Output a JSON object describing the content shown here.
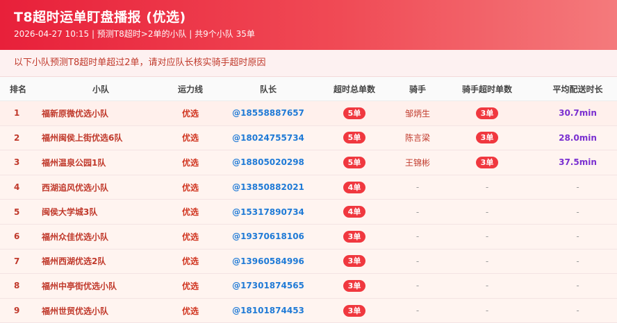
{
  "header": {
    "title": "T8超时运单盯盘播报 (优选)",
    "subtitle": "2026-04-27 10:15 | 预测T8超时>2单的小队 | 共9个小队 35单"
  },
  "notice": "以下小队预测T8超时单超过2单，请对应队长核实骑手超时原因",
  "colors": {
    "header_gradient_start": "#e8203a",
    "header_gradient_end": "#f47a7c",
    "pill": "#f0383f",
    "leader_link": "#1f7ad6",
    "avg_time": "#7a2fd0",
    "team_text": "#c0392b"
  },
  "table": {
    "columns": [
      "排名",
      "小队",
      "运力线",
      "队长",
      "超时总单数",
      "骑手",
      "骑手超时单数",
      "平均配送时长"
    ],
    "rows": [
      {
        "rank": "1",
        "team": "福新原微优选小队",
        "line": "优选",
        "leader": "@18558887657",
        "total": "5单",
        "rider": "邹炳生",
        "rider_ot": "3单",
        "avg": "30.7min"
      },
      {
        "rank": "2",
        "team": "福州闽侯上街优选6队",
        "line": "优选",
        "leader": "@18024755734",
        "total": "5单",
        "rider": "陈言梁",
        "rider_ot": "3单",
        "avg": "28.0min"
      },
      {
        "rank": "3",
        "team": "福州温泉公园1队",
        "line": "优选",
        "leader": "@18805020298",
        "total": "5单",
        "rider": "王锦彬",
        "rider_ot": "3单",
        "avg": "37.5min"
      },
      {
        "rank": "4",
        "team": "西湖追风优选小队",
        "line": "优选",
        "leader": "@13850882021",
        "total": "4单",
        "rider": "-",
        "rider_ot": "-",
        "avg": "-"
      },
      {
        "rank": "5",
        "team": "闽侯大学城3队",
        "line": "优选",
        "leader": "@15317890734",
        "total": "4单",
        "rider": "-",
        "rider_ot": "-",
        "avg": "-"
      },
      {
        "rank": "6",
        "team": "福州众佳优选小队",
        "line": "优选",
        "leader": "@19370618106",
        "total": "3单",
        "rider": "-",
        "rider_ot": "-",
        "avg": "-"
      },
      {
        "rank": "7",
        "team": "福州西湖优选2队",
        "line": "优选",
        "leader": "@13960584996",
        "total": "3单",
        "rider": "-",
        "rider_ot": "-",
        "avg": "-"
      },
      {
        "rank": "8",
        "team": "福州中亭街优选小队",
        "line": "优选",
        "leader": "@17301874565",
        "total": "3单",
        "rider": "-",
        "rider_ot": "-",
        "avg": "-"
      },
      {
        "rank": "9",
        "team": "福州世贸优选小队",
        "line": "优选",
        "leader": "@18101874453",
        "total": "3单",
        "rider": "-",
        "rider_ot": "-",
        "avg": "-"
      }
    ]
  }
}
